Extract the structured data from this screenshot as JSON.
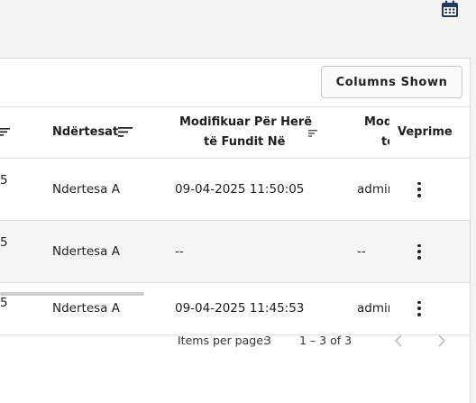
{
  "toolbar": {
    "columns_button_label": "Columns Shown"
  },
  "table": {
    "headers": {
      "ndertesat": "Ndërtesat",
      "modified_at_line1": "Modifikuar Për Herë",
      "modified_at_line2": "të Fundit Në",
      "modified_by_line1": "Mod",
      "modified_by_line2": "të",
      "actions": "Veprime"
    },
    "rows": [
      {
        "first_col_fragment": "5",
        "ndertesa": "Ndertesa A",
        "modified_at": "09-04-2025 11:50:05",
        "modified_by": "admin"
      },
      {
        "first_col_fragment": "5",
        "ndertesa": "Ndertesa A",
        "modified_at": "--",
        "modified_by": "--"
      },
      {
        "first_col_fragment": "5",
        "ndertesa": "Ndertesa A",
        "modified_at": "09-04-2025 11:45:53",
        "modified_by": "admin"
      }
    ]
  },
  "paginator": {
    "items_per_page_label": "Items per page:",
    "items_per_page_value": "3",
    "range_label": "1 – 3 of 3"
  },
  "icons": {
    "calendar": "calendar-icon",
    "sort": "sort-icon",
    "row_actions": "more-vertical-icon",
    "prev": "chevron-left-icon",
    "next": "chevron-right-icon"
  },
  "colors": {
    "accent_icon": "#1f3a5f",
    "disabled": "#c8c8c8"
  }
}
